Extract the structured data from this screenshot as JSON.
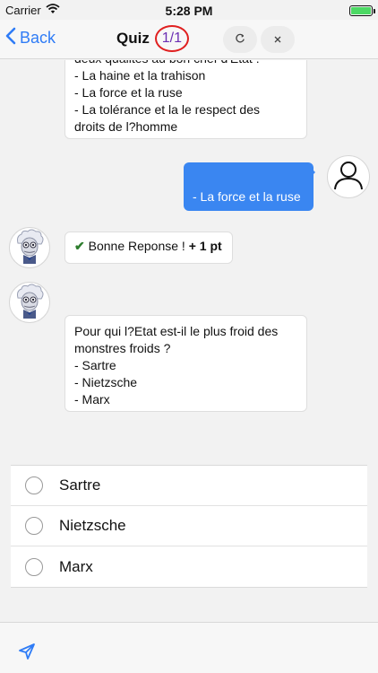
{
  "status_bar": {
    "carrier": "Carrier",
    "time": "5:28 PM",
    "icons": [
      "wifi-icon",
      "battery-icon"
    ],
    "battery_level": 1.0,
    "battery_color": "#4cd964"
  },
  "nav": {
    "back_label": "Back",
    "title": "Quiz",
    "count": "1/1",
    "buttons": [
      "refresh-icon",
      "close-icon"
    ],
    "accent_color": "#2f7cf6"
  },
  "chat": {
    "question_prev": {
      "lines": [
        "deux qualités au bon chef d'Etat :",
        "- La haine et la trahison",
        "- La force et la ruse",
        "- La tolérance et la le respect des",
        "droits de l?homme"
      ]
    },
    "user_answer": "- La force et la ruse",
    "feedback": {
      "text": "Bonne Reponse ! ",
      "points": "+ 1 pt",
      "icon": "check-icon"
    },
    "question_current": {
      "lines": [
        "Pour qui l?Etat est-il le plus froid des",
        "monstres froids ?",
        "- Sartre",
        "- Nietzsche",
        "- Marx"
      ]
    }
  },
  "options": [
    {
      "label": "Sartre"
    },
    {
      "label": "Nietzsche"
    },
    {
      "label": "Marx"
    }
  ],
  "input_bar": {
    "send_icon": "send-icon"
  }
}
